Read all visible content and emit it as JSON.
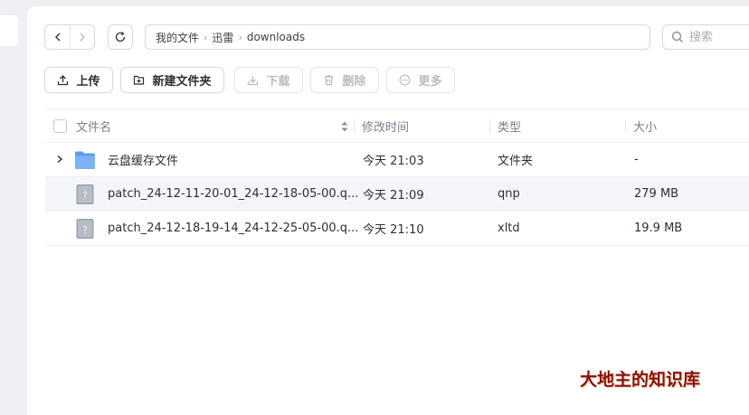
{
  "breadcrumb": [
    "我的文件",
    "迅雷",
    "downloads"
  ],
  "search": {
    "placeholder": "搜索"
  },
  "toolbar": {
    "upload": "上传",
    "new_folder": "新建文件夹",
    "download": "下载",
    "delete": "删除",
    "more": "更多"
  },
  "columns": {
    "name": "文件名",
    "modified": "修改时间",
    "type": "类型",
    "size": "大小"
  },
  "files": [
    {
      "name": "云盘缓存文件",
      "modified": "今天 21:03",
      "type": "文件夹",
      "size": "-",
      "kind": "folder-icon"
    },
    {
      "name": "patch_24-12-11-20-01_24-12-18-05-00.q...",
      "modified": "今天 21:09",
      "type": "qnp",
      "size": "279 MB",
      "kind": "unknown-file-icon"
    },
    {
      "name": "patch_24-12-18-19-14_24-12-25-05-00.q...",
      "modified": "今天 21:10",
      "type": "xltd",
      "size": "19.9 MB",
      "kind": "unknown-file-icon"
    }
  ],
  "watermark": "大地主的知识库",
  "colors": {
    "folder": "#6aa4f0",
    "watermark": "#8a1111"
  }
}
